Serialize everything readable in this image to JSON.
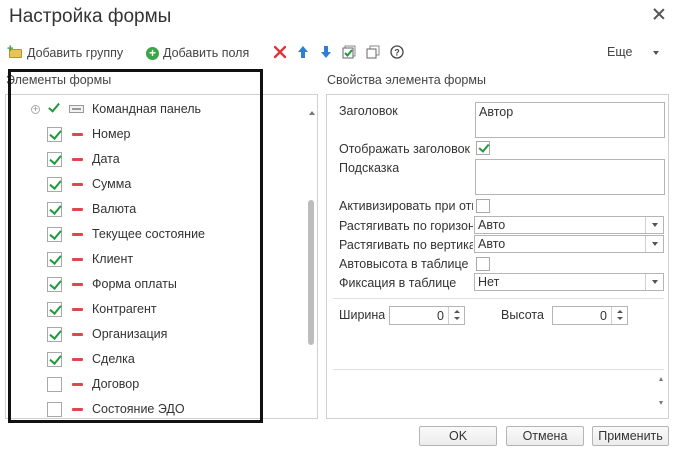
{
  "window": {
    "title": "Настройка формы"
  },
  "toolbar": {
    "add_group_label": "Добавить группу",
    "add_field_label": "Добавить поля",
    "more_label": "Еще"
  },
  "left_section_label": "Элементы формы",
  "right_section_label": "Свойства элемента формы",
  "tree": {
    "command_panel_label": "Командная панель",
    "items": [
      {
        "label": "Номер",
        "checked": true
      },
      {
        "label": "Дата",
        "checked": true
      },
      {
        "label": "Сумма",
        "checked": true
      },
      {
        "label": "Валюта",
        "checked": true
      },
      {
        "label": "Текущее состояние",
        "checked": true
      },
      {
        "label": "Клиент",
        "checked": true
      },
      {
        "label": "Форма оплаты",
        "checked": true
      },
      {
        "label": "Контрагент",
        "checked": true
      },
      {
        "label": "Организация",
        "checked": true
      },
      {
        "label": "Сделка",
        "checked": true
      },
      {
        "label": "Договор",
        "checked": false
      },
      {
        "label": "Состояние ЭДО",
        "checked": false
      }
    ]
  },
  "props": {
    "header_label": "Заголовок",
    "header_value": "Автор",
    "show_header_label": "Отображать заголовок",
    "show_header_checked": true,
    "hint_label": "Подсказка",
    "hint_value": "",
    "activate_label": "Активизировать при отк",
    "activate_checked": false,
    "stretch_h_label": "Растягивать по горизон",
    "stretch_h_value": "Авто",
    "stretch_v_label": "Растягивать по вертика",
    "stretch_v_value": "Авто",
    "auto_height_label": "Автовысота в таблице",
    "auto_height_checked": false,
    "fix_label": "Фиксация в таблице",
    "fix_value": "Нет",
    "width_label": "Ширина",
    "width_value": "0",
    "height_label": "Высота",
    "height_value": "0"
  },
  "buttons": {
    "ok": "OK",
    "cancel": "Отмена",
    "apply": "Применить"
  },
  "colors": {
    "check": "#1f9a3e",
    "field_marker": "#e0474c",
    "delete": "#e0363b",
    "arrow": "#2d7fd3"
  }
}
